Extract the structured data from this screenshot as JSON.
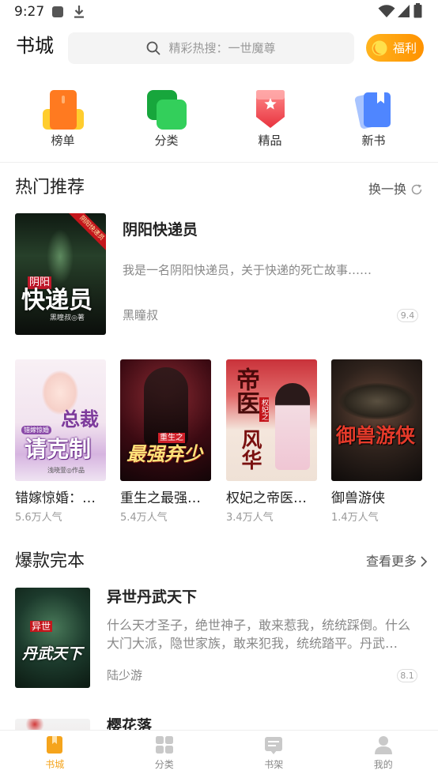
{
  "status_bar": {
    "time": "9:27"
  },
  "header": {
    "title": "书城",
    "search_placeholder": "精彩热搜：一世魔尊",
    "welfare_label": "福利"
  },
  "categories": [
    {
      "label": "榜单",
      "icon": "ranking-icon"
    },
    {
      "label": "分类",
      "icon": "category-icon"
    },
    {
      "label": "精品",
      "icon": "premium-icon"
    },
    {
      "label": "新书",
      "icon": "new-book-icon"
    }
  ],
  "hot_section": {
    "title": "热门推荐",
    "refresh_label": "换一换",
    "featured": {
      "title": "阴阳快递员",
      "description": "我是一名阴阳快递员，关于快递的死亡故事……",
      "author": "黑瞳叔",
      "rating": "9.4",
      "cover": {
        "ribbon": "阴阳快递员",
        "tag": "阴阳",
        "main": "快递员",
        "credit": "黑瞳叔◎著"
      }
    },
    "books": [
      {
        "title": "错嫁惊婚：…",
        "popularity": "5.6万人气",
        "cover": {
          "tag": "错嫁惊婚",
          "main": "总裁",
          "main2": "请克制",
          "credit": "浅晓萱◎作品"
        }
      },
      {
        "title": "重生之最强…",
        "popularity": "5.4万人气",
        "cover": {
          "tag": "重生之",
          "main": "最强弃少"
        }
      },
      {
        "title": "权妃之帝医…",
        "popularity": "3.4万人气",
        "cover": {
          "tag": "权妃之",
          "main": "帝医",
          "main2": "风华"
        }
      },
      {
        "title": "御兽游侠",
        "popularity": "1.4万人气",
        "cover": {
          "main": "御兽游侠"
        }
      }
    ]
  },
  "finished_section": {
    "title": "爆款完本",
    "more_label": "查看更多",
    "books": [
      {
        "title": "异世丹武天下",
        "description": "什么天才圣子，绝世神子，敢来惹我，统统踩倒。什么大门大派，隐世家族，敢来犯我，统统踏平。丹武…",
        "author": "陆少游",
        "rating": "8.1",
        "cover": {
          "tag": "异世",
          "main": "丹武天下"
        }
      },
      {
        "title": "樱花落"
      }
    ]
  },
  "bottom_nav": {
    "tabs": [
      {
        "label": "书城",
        "icon": "bookstore-icon",
        "active": true
      },
      {
        "label": "分类",
        "icon": "category-grid-icon",
        "active": false
      },
      {
        "label": "书架",
        "icon": "bookshelf-icon",
        "active": false
      },
      {
        "label": "我的",
        "icon": "profile-icon",
        "active": false
      }
    ]
  },
  "colors": {
    "accent": "#f5a41c",
    "welfare_start": "#ffb41e",
    "welfare_end": "#ff9200",
    "text_primary": "#222222",
    "text_secondary": "#888888"
  }
}
